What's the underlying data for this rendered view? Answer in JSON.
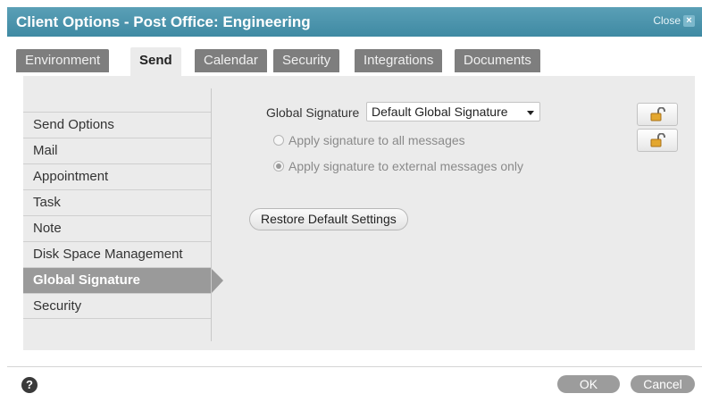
{
  "dialog": {
    "title": "Client Options - Post Office: Engineering",
    "close_label": "Close",
    "close_icon": "close-icon"
  },
  "tabs": [
    {
      "label": "Environment",
      "active": false
    },
    {
      "label": "Send",
      "active": true
    },
    {
      "label": "Calendar",
      "active": false
    },
    {
      "label": "Security",
      "active": false
    },
    {
      "label": "Integrations",
      "active": false
    },
    {
      "label": "Documents",
      "active": false
    }
  ],
  "sidebar": {
    "items": [
      {
        "label": "Send Options"
      },
      {
        "label": "Mail"
      },
      {
        "label": "Appointment"
      },
      {
        "label": "Task"
      },
      {
        "label": "Note"
      },
      {
        "label": "Disk Space Management"
      },
      {
        "label": "Global Signature",
        "selected": true
      },
      {
        "label": "Security"
      }
    ]
  },
  "content": {
    "signature_label": "Global Signature",
    "signature_value": "Default Global Signature",
    "radio_all": "Apply signature to all messages",
    "radio_external": "Apply signature to external messages only",
    "radio_selected": "external",
    "restore_label": "Restore Default Settings",
    "lock_icon": "unlock-icon"
  },
  "footer": {
    "help_icon": "help-icon",
    "help_glyph": "?",
    "ok_label": "OK",
    "cancel_label": "Cancel"
  },
  "colors": {
    "titlebar": "#4b94ad",
    "tab_inactive": "#7e7e7e",
    "panel_bg": "#ebebeb",
    "nav_selected": "#9a9a9a"
  }
}
